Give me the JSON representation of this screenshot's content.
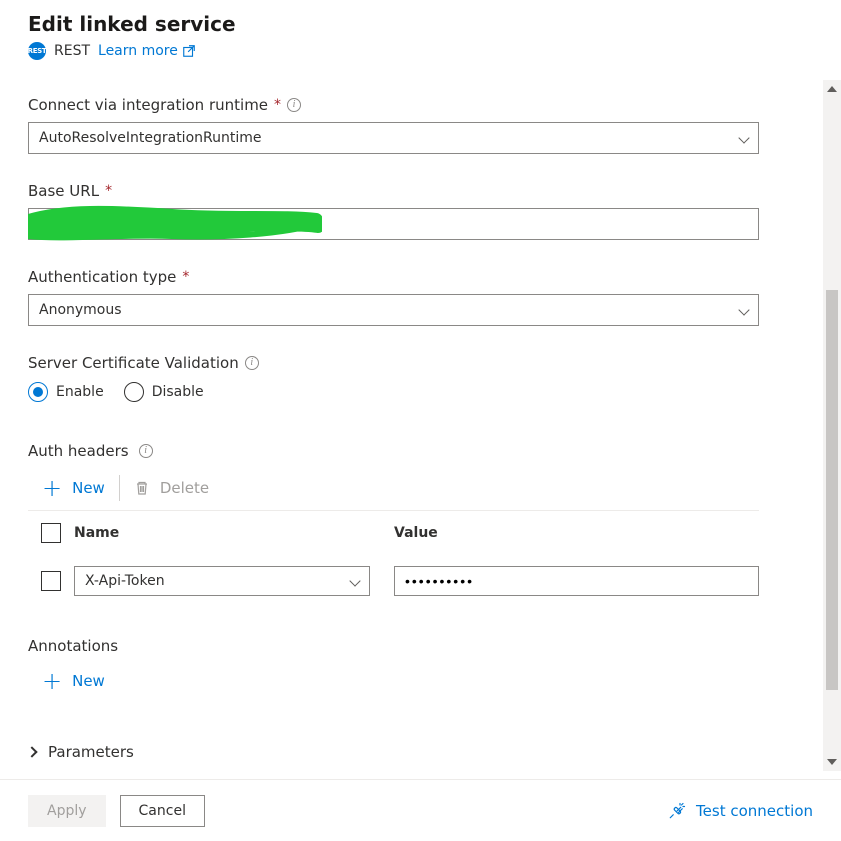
{
  "header": {
    "title": "Edit linked service",
    "type_badge_text": "REST",
    "type_label": "REST",
    "learn_more_label": "Learn more"
  },
  "fields": {
    "runtime": {
      "label": "Connect via integration runtime",
      "required": true,
      "value": "AutoResolveIntegrationRuntime"
    },
    "base_url": {
      "label": "Base URL",
      "required": true,
      "value": ""
    },
    "auth_type": {
      "label": "Authentication type",
      "required": true,
      "value": "Anonymous"
    },
    "cert_validation": {
      "label": "Server Certificate Validation",
      "options": {
        "enable": "Enable",
        "disable": "Disable"
      },
      "selected": "enable"
    }
  },
  "auth_headers": {
    "label": "Auth headers",
    "toolbar": {
      "new_label": "New",
      "delete_label": "Delete"
    },
    "columns": {
      "name": "Name",
      "value": "Value"
    },
    "rows": [
      {
        "name": "X-Api-Token",
        "value_masked": "••••••••••"
      }
    ]
  },
  "annotations": {
    "label": "Annotations",
    "toolbar": {
      "new_label": "New"
    }
  },
  "parameters": {
    "label": "Parameters"
  },
  "footer": {
    "apply_label": "Apply",
    "cancel_label": "Cancel",
    "test_label": "Test connection"
  }
}
